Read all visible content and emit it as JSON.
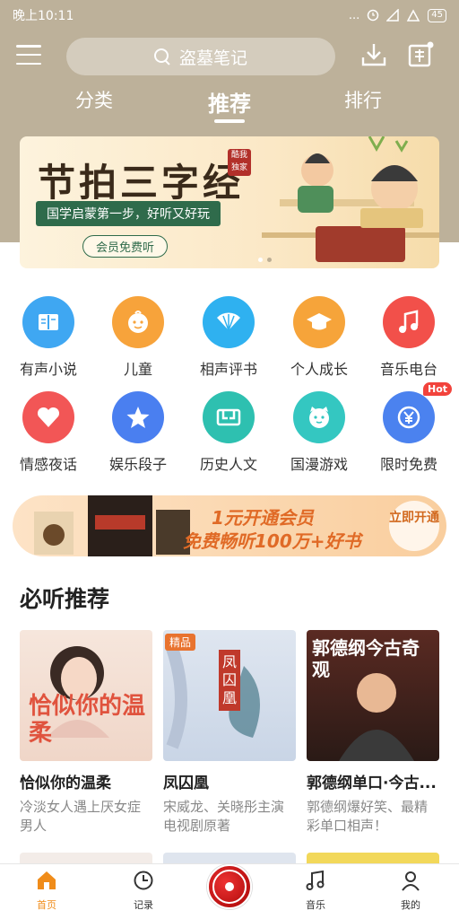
{
  "status": {
    "time": "晚上10:11",
    "signal_text": "...",
    "battery": "45"
  },
  "header": {
    "search_placeholder": "盗墓笔记"
  },
  "tabs": [
    {
      "label": "分类"
    },
    {
      "label": "推荐",
      "active": true
    },
    {
      "label": "排行"
    }
  ],
  "banner": {
    "title": "节拍三字经",
    "subtitle": "国学启蒙第一步，好听又好玩",
    "button": "会员免费听",
    "badge": "酷我独家"
  },
  "categories": [
    {
      "label": "有声小说",
      "color": "#3fa7f2",
      "icon": "book-icon"
    },
    {
      "label": "儿童",
      "color": "#f7a33b",
      "icon": "baby-icon"
    },
    {
      "label": "相声评书",
      "color": "#2fb1f0",
      "icon": "fan-icon"
    },
    {
      "label": "个人成长",
      "color": "#f6a43a",
      "icon": "graduation-cap-icon"
    },
    {
      "label": "音乐电台",
      "color": "#f2504a",
      "icon": "music-note-icon"
    },
    {
      "label": "情感夜话",
      "color": "#f25656",
      "icon": "heart-icon"
    },
    {
      "label": "娱乐段子",
      "color": "#4a7ff0",
      "icon": "star-icon"
    },
    {
      "label": "历史人文",
      "color": "#2ec0b0",
      "icon": "history-icon"
    },
    {
      "label": "国漫游戏",
      "color": "#34c7c1",
      "icon": "cartoon-face-icon"
    },
    {
      "label": "限时免费",
      "color": "#4b82ef",
      "icon": "yen-coin-icon",
      "badge": "Hot"
    }
  ],
  "vip_banner": {
    "line1": "1元开通会员",
    "line2": "免费畅听100万+好书",
    "button": "立即开通"
  },
  "section": {
    "title": "必听推荐"
  },
  "recommendations": [
    {
      "title": "恰似你的温柔",
      "desc": "冷淡女人遇上厌女症男人",
      "cover_text": "恰似你的温柔"
    },
    {
      "title": "凤囚凰",
      "desc": "宋威龙、关晓彤主演电视剧原著",
      "cover_text": "凤囚凰",
      "tag": "精品"
    },
    {
      "title": "郭德纲单口·今古...",
      "desc": "郭德纲爆好笑、最精彩单口相声！",
      "cover_text": "郭德纲今古奇观"
    }
  ],
  "bottom_nav": [
    {
      "label": "首页",
      "active": true
    },
    {
      "label": "记录"
    },
    {
      "label": "音乐"
    },
    {
      "label": "我的"
    }
  ],
  "colors": {
    "accent": "#f08c1a",
    "header_bg": "#bdb19a"
  }
}
